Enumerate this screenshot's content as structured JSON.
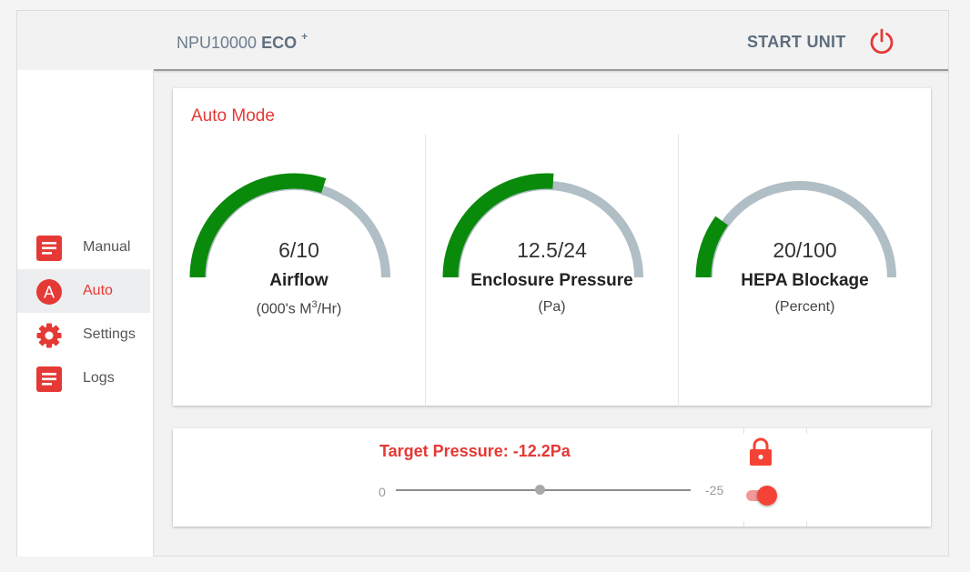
{
  "header": {
    "title_main": "NPU10000",
    "title_bold": "ECO",
    "title_sup": "+",
    "start_label": "START UNIT"
  },
  "sidebar": {
    "items": [
      {
        "label": "Manual",
        "icon": "document-icon"
      },
      {
        "label": "Auto",
        "icon": "auto-a-icon",
        "active": true
      },
      {
        "label": "Settings",
        "icon": "gear-icon"
      },
      {
        "label": "Logs",
        "icon": "document-icon"
      }
    ]
  },
  "auto_mode": {
    "title": "Auto Mode",
    "gauges": [
      {
        "value_text": "6/10",
        "label": "Airflow",
        "unit_pre": "(000's M",
        "unit_sup": "3",
        "unit_post": "/Hr)",
        "value": 6,
        "max": 10
      },
      {
        "value_text": "12.5/24",
        "label": "Enclosure Pressure",
        "unit_pre": "(Pa)",
        "unit_sup": "",
        "unit_post": "",
        "value": 12.5,
        "max": 24
      },
      {
        "value_text": "20/100",
        "label": "HEPA Blockage",
        "unit_pre": "(Percent)",
        "unit_sup": "",
        "unit_post": "",
        "value": 20,
        "max": 100
      }
    ]
  },
  "target_pressure": {
    "title": "Target Pressure: -12.2Pa",
    "slider_min": "0",
    "slider_max": "-25",
    "value": -12.2,
    "toggle_on": true
  },
  "colors": {
    "accent": "#e53935",
    "gauge_fill": "#0a8a0a",
    "gauge_track": "#b0bec5"
  }
}
